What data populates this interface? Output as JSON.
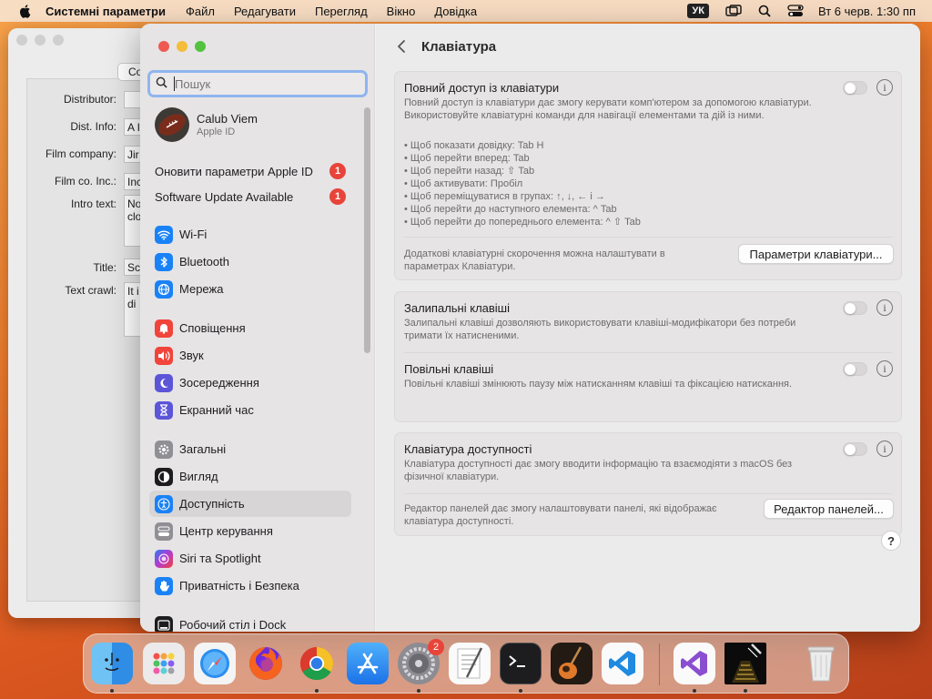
{
  "menubar": {
    "app_name": "Системні параметри",
    "items": [
      "Файл",
      "Редагувати",
      "Перегляд",
      "Вікно",
      "Довідка"
    ],
    "input_source": "УК",
    "datetime": "Вт 6 черв.  1:30 пп"
  },
  "bg_window": {
    "button_label": "Co",
    "labels": [
      "Distributor:",
      "Dist. Info:",
      "Film company:",
      "Film co. Inc.:",
      "Intro text:",
      "Title:",
      "Text crawl:"
    ],
    "values": [
      "",
      "A I",
      "Jir",
      "Inc",
      "No\nclo",
      "Sc",
      "It i\ndi"
    ]
  },
  "sidebar": {
    "search_placeholder": "Пошук",
    "profile_name": "Calub Viem",
    "profile_sub": "Apple ID",
    "alerts": [
      {
        "label": "Оновити параметри Apple ID",
        "badge": "1"
      },
      {
        "label": "Software Update Available",
        "badge": "1"
      }
    ],
    "items": [
      {
        "label": "Wi-Fi",
        "icon": "wifi-icon",
        "color": "#1a82f7"
      },
      {
        "label": "Bluetooth",
        "icon": "bluetooth-icon",
        "color": "#1a82f7"
      },
      {
        "label": "Мережа",
        "icon": "globe-icon",
        "color": "#1a82f7"
      },
      {
        "label": "Сповіщення",
        "icon": "bell-icon",
        "color": "#f1443a"
      },
      {
        "label": "Звук",
        "icon": "speaker-icon",
        "color": "#f1443a"
      },
      {
        "label": "Зосередження",
        "icon": "moon-icon",
        "color": "#5c55d8"
      },
      {
        "label": "Екранний час",
        "icon": "hourglass-icon",
        "color": "#5c55d8"
      },
      {
        "label": "Загальні",
        "icon": "gear-icon",
        "color": "#8f8f94"
      },
      {
        "label": "Вигляд",
        "icon": "appearance-icon",
        "color": "#1d1d1f"
      },
      {
        "label": "Доступність",
        "icon": "accessibility-icon",
        "color": "#1a82f7"
      },
      {
        "label": "Центр керування",
        "icon": "control-center-icon",
        "color": "#8f8f94"
      },
      {
        "label": "Siri та Spotlight",
        "icon": "siri-icon",
        "color": "#b43ad0"
      },
      {
        "label": "Приватність і Безпека",
        "icon": "hand-icon",
        "color": "#1a82f7"
      },
      {
        "label": "Робочий стіл і Dock",
        "icon": "dock-icon",
        "color": "#1d1d1f"
      }
    ],
    "selected": "Доступність"
  },
  "content": {
    "title": "Клавіатура",
    "full_access": {
      "title": "Повний доступ із клавіатури",
      "desc": "Повний доступ із клавіатури дає змогу керувати комп'ютером за допомогою клавіатури. Використовуйте клавіатурні команди для навігації елементами та дій із ними.",
      "shortcuts": [
        "• Щоб показати довідку: Tab H",
        "• Щоб перейти вперед: Tab",
        "• Щоб перейти назад: ⇧ Tab",
        "• Щоб активувати: Пробіл",
        "• Щоб переміщуватися в групах: ↑, ↓, ← і →",
        "• Щоб перейти до наступного елемента: ^ Tab",
        "• Щоб перейти до попереднього елемента: ^ ⇧ Tab"
      ],
      "extra": "Додаткові клавіатурні скорочення можна налаштувати в параметрах Клавіатури.",
      "button": "Параметри клавіатури..."
    },
    "sticky": {
      "title": "Залипальні клавіші",
      "desc": "Залипальні клавіші дозволяють використовувати клавіші-модифікатори без потреби тримати їх натисненими."
    },
    "slow": {
      "title": "Повільні клавіші",
      "desc": "Повільні клавіші змінюють паузу між натисканням клавіші та фіксацією натискання."
    },
    "acc_keyboard": {
      "title": "Клавіатура доступності",
      "desc": "Клавіатура доступності дає змогу вводити інформацію та взаємодіяти з macOS без фізичної клавіатури.",
      "panel_desc": "Редактор панелей дає змогу налаштовувати панелі, які відображає клавіатура доступності.",
      "button": "Редактор панелей..."
    },
    "help": "?"
  },
  "dock": {
    "apps": [
      "finder-icon",
      "launchpad-icon",
      "safari-icon",
      "firefox-icon",
      "chrome-icon",
      "app-store-icon",
      "system-settings-icon",
      "textedit-icon",
      "terminal-icon",
      "garageband-icon",
      "vscode-icon",
      "visual-studio-icon",
      "starwars-crawl-icon",
      "trash-icon"
    ],
    "settings_badge": "2"
  }
}
